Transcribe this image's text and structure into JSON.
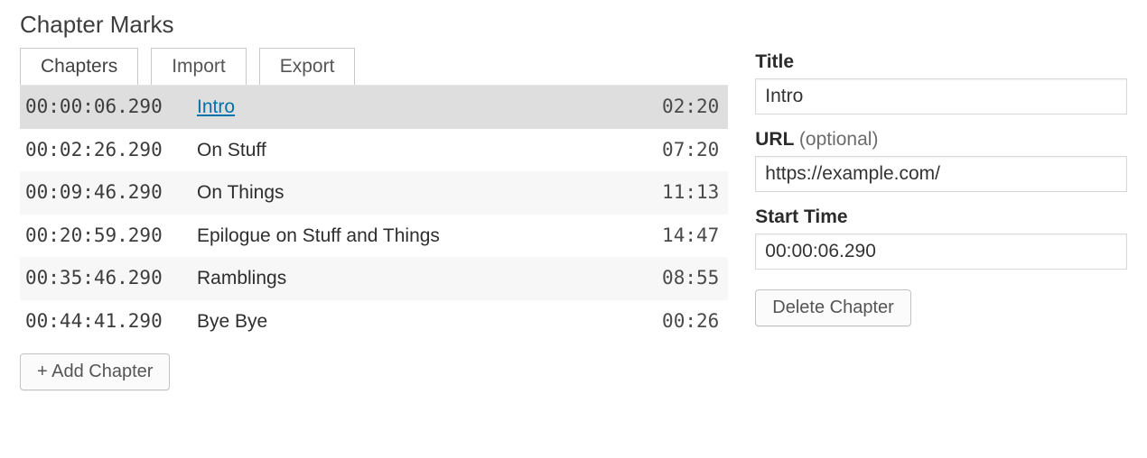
{
  "title": "Chapter Marks",
  "tabs": [
    {
      "label": "Chapters",
      "active": true
    },
    {
      "label": "Import",
      "active": false
    },
    {
      "label": "Export",
      "active": false
    }
  ],
  "chapters": [
    {
      "start": "00:00:06.290",
      "title": "Intro",
      "duration": "02:20",
      "selected": true,
      "hasUrl": true
    },
    {
      "start": "00:02:26.290",
      "title": "On Stuff",
      "duration": "07:20",
      "selected": false,
      "hasUrl": false
    },
    {
      "start": "00:09:46.290",
      "title": "On Things",
      "duration": "11:13",
      "selected": false,
      "hasUrl": false
    },
    {
      "start": "00:20:59.290",
      "title": "Epilogue on Stuff and Things",
      "duration": "14:47",
      "selected": false,
      "hasUrl": false
    },
    {
      "start": "00:35:46.290",
      "title": "Ramblings",
      "duration": "08:55",
      "selected": false,
      "hasUrl": false
    },
    {
      "start": "00:44:41.290",
      "title": "Bye Bye",
      "duration": "00:26",
      "selected": false,
      "hasUrl": false
    }
  ],
  "add_chapter_label": "+ Add Chapter",
  "editor": {
    "title_label": "Title",
    "title_value": "Intro",
    "url_label": "URL",
    "url_hint": "(optional)",
    "url_value": "https://example.com/",
    "start_label": "Start Time",
    "start_value": "00:00:06.290",
    "delete_label": "Delete Chapter"
  }
}
